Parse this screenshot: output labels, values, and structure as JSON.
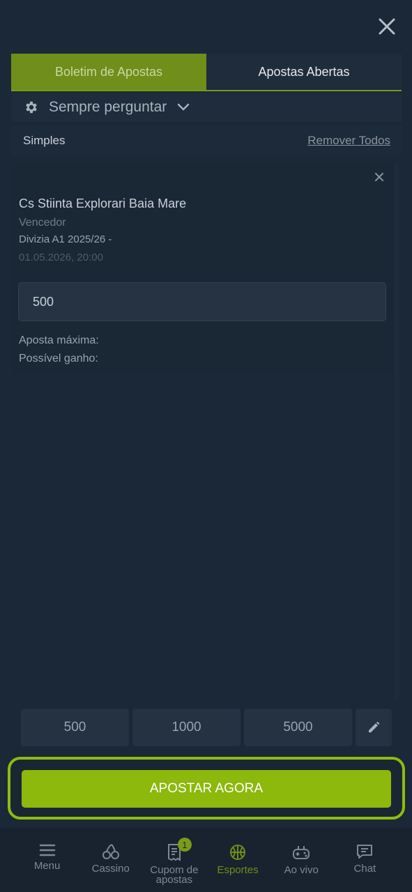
{
  "colors": {
    "accent": "#8db80c",
    "background": "#1b2838",
    "active_tab": "#6f8e1a"
  },
  "tabs": [
    {
      "label": "Boletim de Apostas",
      "active": true
    },
    {
      "label": "Apostas Abertas",
      "active": false
    }
  ],
  "settings": {
    "icon": "gear-icon",
    "label": "Sempre perguntar",
    "chevron": "chevron-down-icon"
  },
  "slip": {
    "type_label": "Simples",
    "remove_all": "Remover Todos"
  },
  "bet": {
    "team": "Cs Stiinta Explorari Baia Mare",
    "market": "Vencedor",
    "league": "Divizia A1 2025/26 -",
    "date": "01.05.2026, 20:00",
    "stake_value": "500",
    "max_bet_label": "Aposta máxima:",
    "possible_gain_label": "Possível ganho:"
  },
  "quick_stakes": [
    "500",
    "1000",
    "5000"
  ],
  "quick_edit_icon": "pencil-icon",
  "bet_now_label": "APOSTAR AGORA",
  "bottom_nav": [
    {
      "label": "Menu",
      "icon": "hamburger-icon",
      "active": false
    },
    {
      "label": "Cassino",
      "icon": "cherries-icon",
      "active": false
    },
    {
      "label": "Cupom de apostas",
      "icon": "receipt-icon",
      "active": false,
      "badge": "1"
    },
    {
      "label": "Esportes",
      "icon": "basketball-icon",
      "active": true
    },
    {
      "label": "Ao vivo",
      "icon": "gamepad-icon",
      "active": false
    },
    {
      "label": "Chat",
      "icon": "chat-icon",
      "active": false
    }
  ]
}
